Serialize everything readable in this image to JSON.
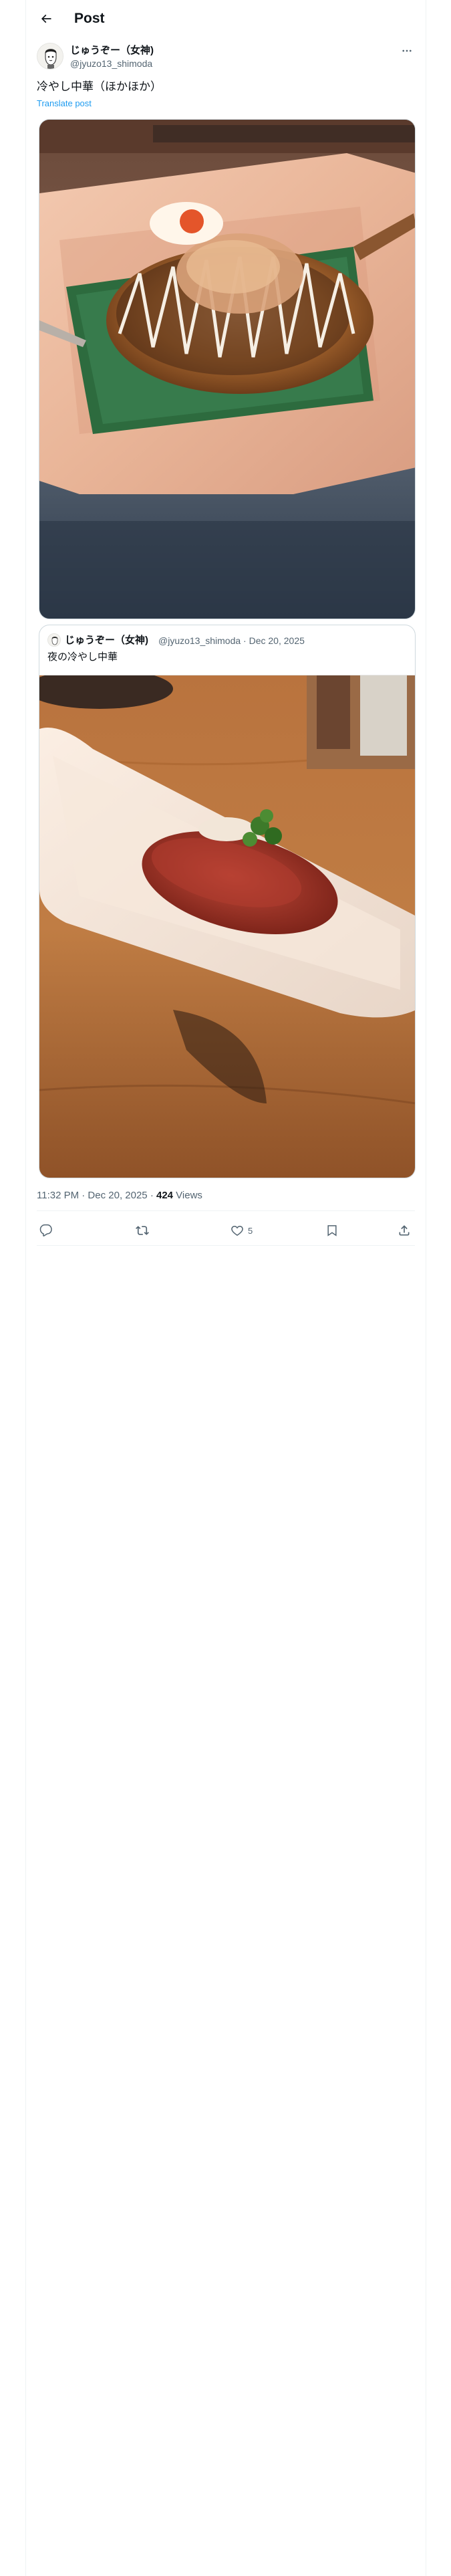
{
  "header": {
    "title": "Post"
  },
  "post": {
    "author_name": "じゅうぞー（女神)",
    "author_handle": "@jyuzo13_shimoda",
    "text": "冷やし中華（ほかほか）",
    "translate_label": "Translate post",
    "timestamp": "11:32 PM · Dec 20, 2025 · ",
    "views_count": "424",
    "views_label": " Views"
  },
  "quote": {
    "author_name": "じゅうぞー（女神)",
    "meta": "@jyuzo13_shimoda · Dec 20, 2025",
    "text": "夜の冷やし中華"
  },
  "actions": {
    "reply_count": "",
    "repost_count": "",
    "like_count": "5"
  },
  "colors": {
    "link": "#1d9bf0",
    "secondary_text": "#536471",
    "border": "#cfd9de"
  },
  "icons": [
    "back-arrow-icon",
    "more-icon",
    "reply-icon",
    "repost-icon",
    "like-icon",
    "bookmark-icon",
    "share-icon"
  ]
}
